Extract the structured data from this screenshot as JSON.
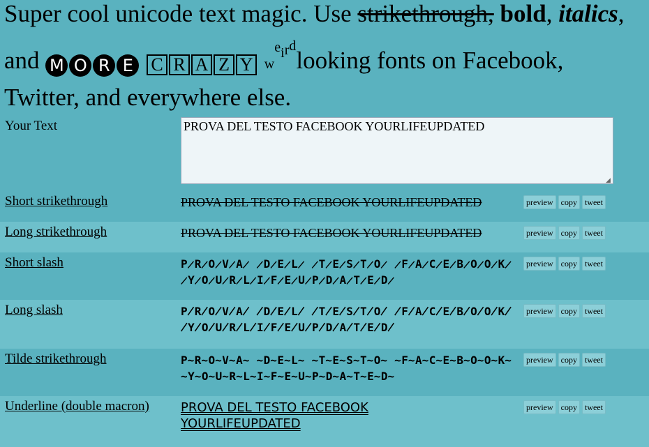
{
  "intro": {
    "part1": "Super cool unicode text magic. Use ",
    "strike": "strikethrough,",
    "sep1": " ",
    "bold": "bold",
    "sep2": ",",
    "italics": "italics",
    "sep3": ", and ",
    "more": [
      "M",
      "O",
      "R",
      "E"
    ],
    "crazy": [
      "C",
      "R",
      "A",
      "Z",
      "Y"
    ],
    "weird": [
      "w",
      "e",
      "i",
      "r",
      "d"
    ],
    "part2": "looking fonts on Facebook, Twitter, and everywhere else."
  },
  "input": {
    "label": "Your Text",
    "value": "PROVA DEL TESTO FACEBOOK YOURLIFEUPDATED"
  },
  "buttons": {
    "preview": "preview",
    "copy": "copy",
    "tweet": "tweet"
  },
  "rows": [
    {
      "label": "Short strikethrough",
      "output": "PROVA DEL TESTO FACEBOOK YOURLIFEUPDATED"
    },
    {
      "label": "Long strikethrough",
      "output": "PROVA DEL TESTO FACEBOOK YOURLIFEUPDATED"
    },
    {
      "label": "Short slash",
      "output": "P̷R̷O̷V̷A̷ ̷D̷E̷L̷ ̷T̷E̷S̷T̷O̷ ̷F̷A̷C̷E̷B̷O̷O̷K̷ ̷Y̷O̷U̷R̷L̷I̷F̷E̷U̷P̷D̷A̷T̷E̷D̷"
    },
    {
      "label": "Long slash",
      "output": "P̸R̸O̸V̸A̸ ̸D̸E̸L̸ ̸T̸E̸S̸T̸O̸ ̸F̸A̸C̸E̸B̸O̸O̸K̸ ̸Y̸O̸U̸R̸L̸I̸F̸E̸U̸P̸D̸A̸T̸E̸D̸"
    },
    {
      "label": "Tilde strikethrough",
      "output": "P̴R̴O̴V̴A̴ ̴D̴E̴L̴ ̴T̴E̴S̴T̴O̴ ̴F̴A̴C̴E̴B̴O̴O̴K̴ ̴Y̴O̴U̴R̴L̴I̴F̴E̴U̴P̴D̴A̴T̴E̴D̴"
    },
    {
      "label": "Underline (double macron)",
      "output": "PROVA DEL TESTO FACEBOOK YOURLIFEUPDATED"
    }
  ]
}
